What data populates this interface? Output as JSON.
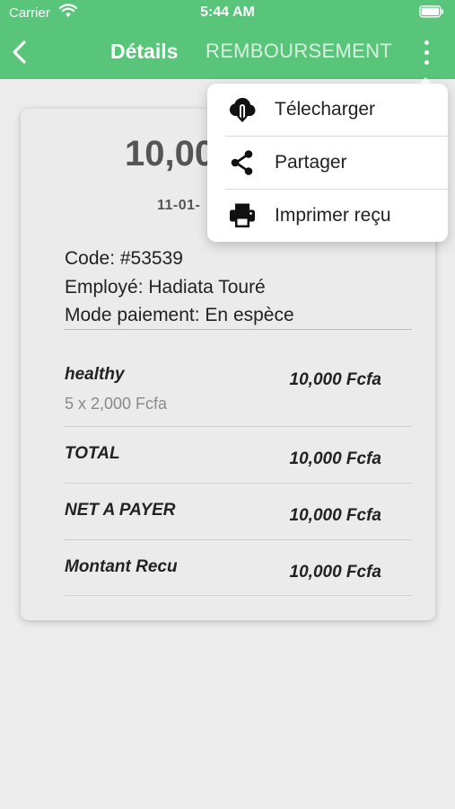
{
  "status_bar": {
    "carrier": "Carrier",
    "time": "5:44 AM"
  },
  "nav": {
    "tab_details": "Détails",
    "tab_refund": "REMBOURSEMENT"
  },
  "receipt": {
    "amount": "10,00",
    "date": "11-01-",
    "code": "Code: #53539",
    "employee": "Employé: Hadiata Touré",
    "payment_mode": "Mode paiement: En espèce",
    "items": [
      {
        "name": "healthy",
        "detail": "5 x 2,000 Fcfa",
        "value": "10,000 Fcfa"
      }
    ],
    "total_label": "TOTAL",
    "total_value": "10,000 Fcfa",
    "net_label": "NET A PAYER",
    "net_value": "10,000 Fcfa",
    "received_label": "Montant Recu",
    "received_value": "10,000 Fcfa"
  },
  "menu": {
    "download": "Télecharger",
    "share": "Partager",
    "print": "Imprimer reçu"
  },
  "colors": {
    "accent": "#58c57a",
    "background": "#ececec",
    "card": "#ebebeb"
  },
  "icons": [
    "wifi-icon",
    "battery-icon",
    "back-arrow-icon",
    "more-vert-icon",
    "cloud-download-icon",
    "share-icon",
    "print-icon"
  ]
}
